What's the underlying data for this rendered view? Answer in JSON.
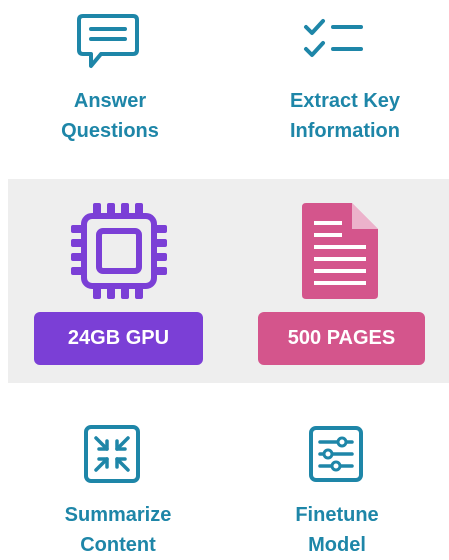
{
  "colors": {
    "teal": "#1e86a8",
    "purple": "#7b3fd6",
    "pink": "#d4558c",
    "panel_background": "#eeeeee"
  },
  "features": {
    "answer_questions": {
      "icon": "chat-bubble-icon",
      "line1": "Answer",
      "line2": "Questions"
    },
    "extract_key_information": {
      "icon": "checklist-icon",
      "line1": "Extract Key",
      "line2": "Information"
    },
    "summarize_content": {
      "icon": "compress-arrows-icon",
      "line1": "Summarize",
      "line2": "Content"
    },
    "finetune_model": {
      "icon": "sliders-icon",
      "line1": "Finetune",
      "line2": "Model"
    }
  },
  "resources": {
    "gpu": {
      "icon": "cpu-chip-icon",
      "label": "24GB GPU"
    },
    "pages": {
      "icon": "document-icon",
      "label": "500 PAGES"
    }
  }
}
